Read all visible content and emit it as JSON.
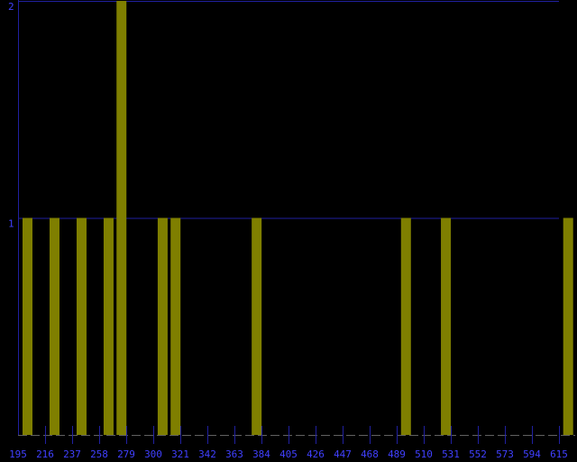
{
  "chart_data": {
    "type": "bar",
    "title": "",
    "xlabel": "",
    "ylabel": "",
    "x_tick_labels": [
      "195",
      "216",
      "237",
      "258",
      "279",
      "300",
      "321",
      "342",
      "363",
      "384",
      "405",
      "426",
      "447",
      "468",
      "489",
      "510",
      "531",
      "552",
      "573",
      "594",
      "615"
    ],
    "y_tick_labels": [
      "1",
      "2"
    ],
    "xlim": [
      195,
      615
    ],
    "ylim": [
      0,
      2
    ],
    "bar_width": 7,
    "series": [
      {
        "x": [
          195,
          216,
          237,
          258,
          268,
          300,
          310,
          373,
          489,
          520,
          615
        ],
        "values": [
          1,
          1,
          1,
          1,
          2,
          1,
          1,
          1,
          1,
          1,
          1
        ]
      }
    ],
    "grid": "horizontal lines at 1 and 2",
    "legend": "none",
    "colors": {
      "background": "#000000",
      "bar": "#7f7f00",
      "axis": "#2020a0",
      "grid": "#2020a0",
      "tick_label": "#4040ff",
      "baseline": "#606060"
    }
  }
}
